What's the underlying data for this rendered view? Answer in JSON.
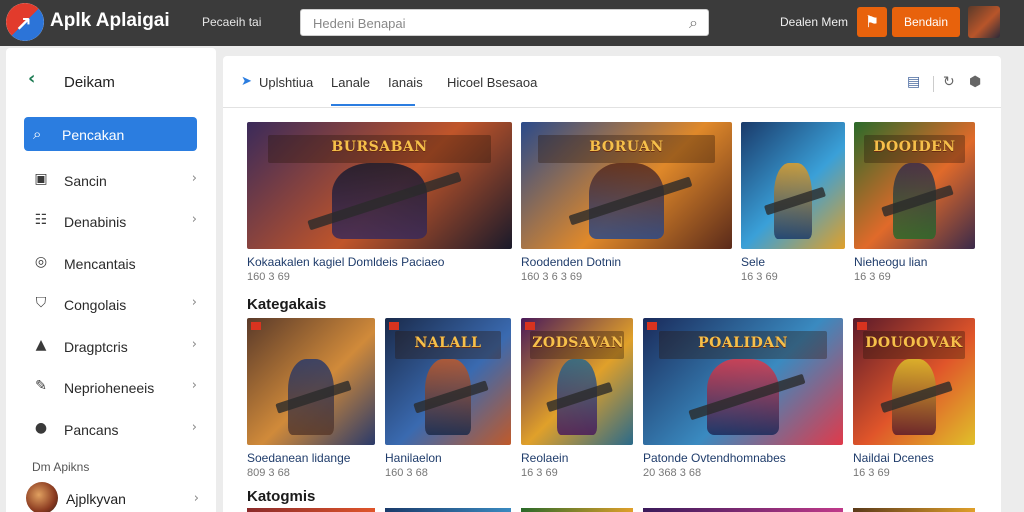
{
  "header": {
    "app_title": "Aplk Aplaigai",
    "top_link": "Pecaeih tai",
    "search_placeholder": "Hedeni Benapai",
    "user_text": "Dealen Mem",
    "primary_button": "Bendain"
  },
  "sidebar": {
    "header_label": "Deikam",
    "active_item": "Pencakan",
    "items": [
      {
        "label": "Sancin",
        "icon": "square-icon"
      },
      {
        "label": "Denabinis",
        "icon": "list-icon"
      },
      {
        "label": "Mencantais",
        "icon": "circle-icon"
      },
      {
        "label": "Congolais",
        "icon": "shield-icon"
      },
      {
        "label": "Dragptcris",
        "icon": "lock-icon"
      },
      {
        "label": "Neprioheneeis",
        "icon": "pencil-icon"
      },
      {
        "label": "Pancans",
        "icon": "person-icon"
      }
    ],
    "sub_label": "Dm  Apikns",
    "user_label": "Ajplkyvan"
  },
  "tabs": [
    {
      "label": "Uplshtiua"
    },
    {
      "label": "Lanale"
    },
    {
      "label": "Ianais"
    },
    {
      "label": "Hicoel Bsesaoa"
    }
  ],
  "sections": {
    "row1": {
      "cards": [
        {
          "title": "Kokaakalen kagiel Domldeis Paciaeo",
          "meta": "160 3 69",
          "header": "BURSABAN",
          "c1": "#3a2a5a",
          "c2": "#c0552a",
          "c3": "#1a1a2a"
        },
        {
          "title": "Roodenden Dotnin",
          "meta": "160 3 6 3 69",
          "header": "BORUAN",
          "c1": "#2a4a8a",
          "c2": "#e0892a",
          "c3": "#5a2a1a"
        },
        {
          "title": "Sele",
          "meta": "16 3 69",
          "header": "",
          "c1": "#1a3a6a",
          "c2": "#3aa0d8",
          "c3": "#e0a02a"
        },
        {
          "title": "Nieheogu lian",
          "meta": "16 3 69",
          "header": "DOOIDEN",
          "c1": "#2a6a2a",
          "c2": "#e06a2a",
          "c3": "#3a2a4a"
        }
      ]
    },
    "row2_title": "Kategakais",
    "row2": {
      "cards": [
        {
          "title": "Soedanean lidange",
          "meta": "809 3 68",
          "header": "",
          "c1": "#5a3a2a",
          "c2": "#d08a3a",
          "c3": "#2a3a6a"
        },
        {
          "title": "Hanilaelon",
          "meta": "160 3 68",
          "header": "NALALL",
          "c1": "#1a2a4a",
          "c2": "#3a6ab0",
          "c3": "#c05a2a"
        },
        {
          "title": "Reolaein",
          "meta": "16 3 69",
          "header": "ZODSAVAN",
          "c1": "#4a1a5a",
          "c2": "#e0a02a",
          "c3": "#2a6a8a"
        },
        {
          "title": "Patonde Ovtendhomnabes",
          "meta": "20 368 3 68",
          "header": "POALIDAN",
          "c1": "#1a2a5a",
          "c2": "#3a8ac0",
          "c3": "#e03a4a"
        },
        {
          "title": "Naildai Dcenes",
          "meta": "16 3 69",
          "header": "DOUOOVAK",
          "c1": "#5a1a2a",
          "c2": "#e0552a",
          "c3": "#e0c02a"
        }
      ]
    },
    "row3_title": "Katogmis"
  },
  "colors": {
    "accent": "#2b7de0",
    "brand_orange": "#e8620c",
    "topbar": "#3b3b3b"
  }
}
